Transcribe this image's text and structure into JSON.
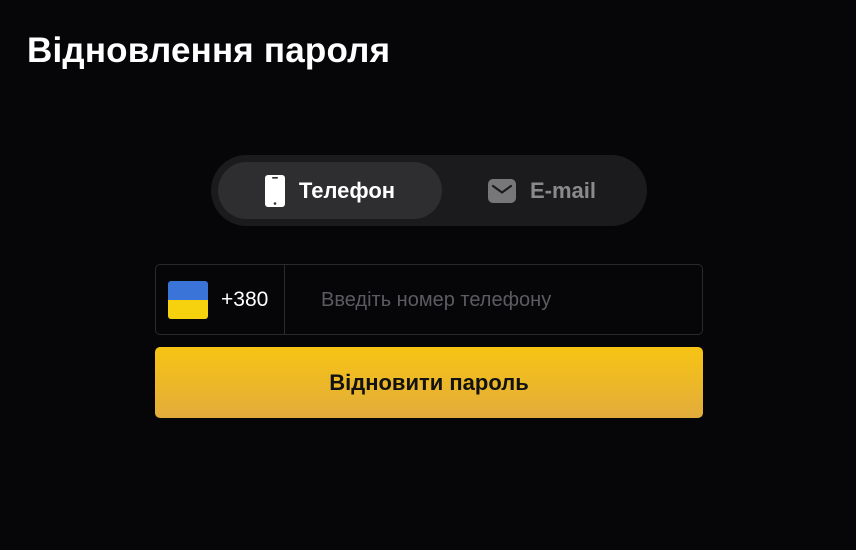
{
  "header": {
    "title": "Відновлення пароля"
  },
  "tabs": [
    {
      "label": "Телефон",
      "icon": "phone-icon",
      "active": true
    },
    {
      "label": "E-mail",
      "icon": "mail-icon",
      "active": false
    }
  ],
  "phone_field": {
    "country_flag": "ukraine-flag",
    "dial_code": "+380",
    "value": "",
    "placeholder": "Введіть номер телефону"
  },
  "submit": {
    "label": "Відновити пароль"
  },
  "colors": {
    "background": "#060608",
    "tab_track": "#1b1b1d",
    "tab_active": "#2e2e31",
    "accent_top": "#f7c413",
    "accent_bottom": "#e2ac3c",
    "flag_blue": "#3a74d8",
    "flag_yellow": "#f6d20e"
  }
}
